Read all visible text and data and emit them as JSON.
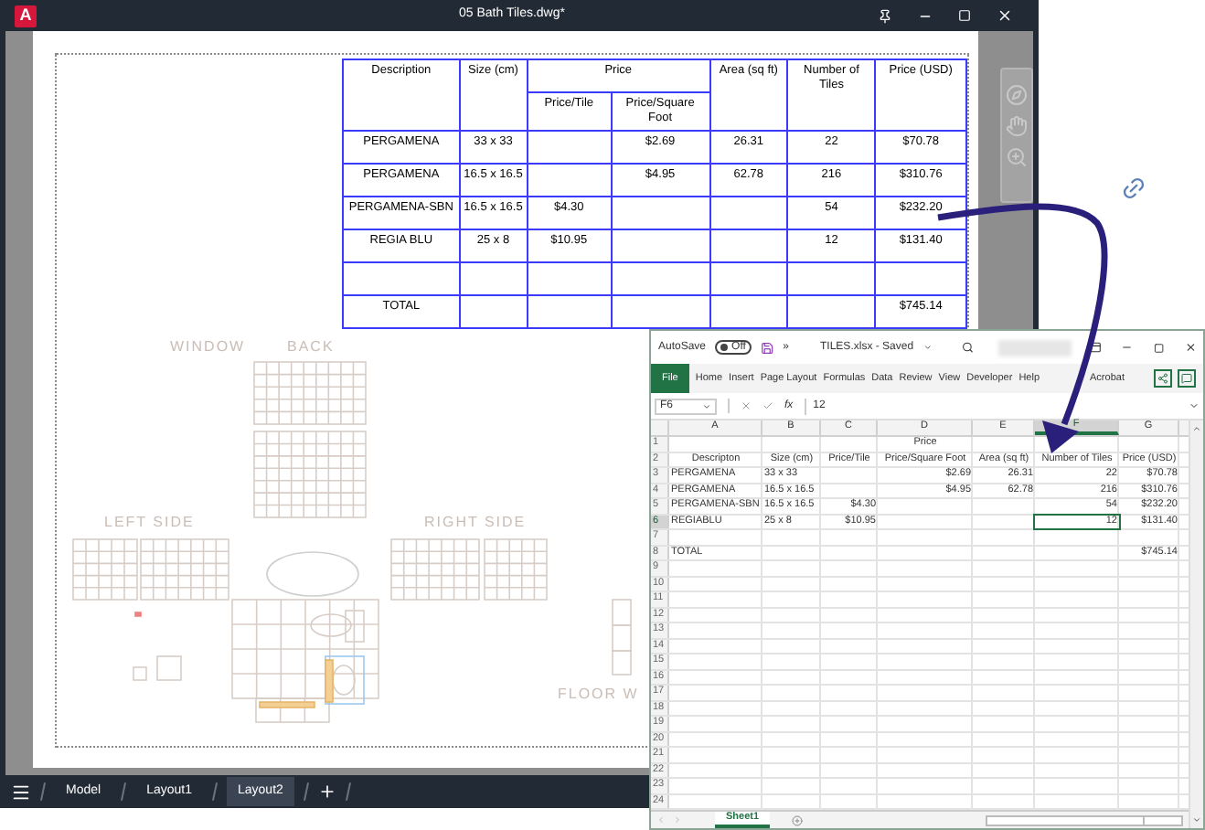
{
  "cad": {
    "logo": "A",
    "title": "05 Bath Tiles.dwg*",
    "table": {
      "headers": [
        {
          "label": "Description"
        },
        {
          "label": "Size (cm)"
        },
        {
          "label": "Price",
          "sub": [
            "Price/Tile",
            "Price/Square Foot"
          ]
        },
        {
          "label": "Area (sq ft)"
        },
        {
          "label": "Number of Tiles"
        },
        {
          "label": "Price (USD)"
        }
      ],
      "rows": [
        [
          "PERGAMENA",
          "33 x 33",
          null,
          "$2.69",
          "26.31",
          "22",
          "$70.78"
        ],
        [
          "PERGAMENA",
          "16.5 x 16.5",
          null,
          "$4.95",
          "62.78",
          "216",
          "$310.76"
        ],
        [
          "PERGAMENA-SBN",
          "16.5 x 16.5",
          "$4.30",
          null,
          null,
          "54",
          "$232.20"
        ],
        [
          "REGIA BLU",
          "25 x 8",
          "$10.95",
          null,
          null,
          "12",
          "$131.40"
        ],
        [],
        [
          "TOTAL",
          null,
          null,
          null,
          null,
          null,
          "$745.14"
        ]
      ]
    },
    "labels": [
      "WINDOW",
      "BACK",
      "LEFT SIDE",
      "RIGHT SIDE",
      "FLOOR W"
    ],
    "layout_tabs": [
      {
        "label": "Model",
        "selected": false
      },
      {
        "label": "Layout1",
        "selected": false
      },
      {
        "label": "Layout2",
        "selected": true
      }
    ]
  },
  "excel": {
    "autosave": {
      "label": "AutoSave",
      "on": false,
      "state_label": "Off"
    },
    "more": "»",
    "title": "TILES.xlsx - Saved",
    "ribbon_tabs": [
      {
        "label": "File",
        "kind": "file"
      },
      {
        "label": "Home",
        "kind": "tab"
      },
      {
        "label": "Insert",
        "kind": "tab"
      },
      {
        "label": "Page Layout",
        "kind": "tab"
      },
      {
        "label": "Formulas",
        "kind": "tab"
      },
      {
        "label": "Data",
        "kind": "tab"
      },
      {
        "label": "Review",
        "kind": "tab"
      },
      {
        "label": "View",
        "kind": "tab"
      },
      {
        "label": "Developer",
        "kind": "tab"
      },
      {
        "label": "Help",
        "kind": "tab"
      },
      {
        "label": "Acrobat",
        "kind": "tab"
      }
    ],
    "name_box": "F6",
    "function_label": "fx",
    "formula": "12",
    "columns": [
      {
        "label": "A",
        "selected": false
      },
      {
        "label": "B",
        "selected": false
      },
      {
        "label": "C",
        "selected": false
      },
      {
        "label": "D",
        "selected": false
      },
      {
        "label": "E",
        "selected": false
      },
      {
        "label": "F",
        "selected": true
      },
      {
        "label": "G",
        "selected": false
      }
    ],
    "rows": [
      {
        "number": "1",
        "kind": "header",
        "selected": false,
        "cells": [
          null,
          null,
          null,
          "Price",
          null,
          null,
          null
        ]
      },
      {
        "number": "2",
        "kind": "header",
        "selected": false,
        "cells": [
          "Descripton",
          "Size (cm)",
          "Price/Tile",
          "Price/Square Foot",
          "Area (sq ft)",
          "Number of Tiles",
          "Price (USD)"
        ]
      },
      {
        "number": "3",
        "kind": "data",
        "selected": false,
        "cells": [
          "PERGAMENA",
          "33 x 33",
          null,
          "$2.69",
          "26.31",
          "22",
          "$70.78"
        ]
      },
      {
        "number": "4",
        "kind": "data",
        "selected": false,
        "cells": [
          "PERGAMENA",
          "16.5 x 16.5",
          null,
          "$4.95",
          "62.78",
          "216",
          "$310.76"
        ]
      },
      {
        "number": "5",
        "kind": "data",
        "selected": false,
        "cells": [
          "PERGAMENA-SBN",
          "16.5 x 16.5",
          "$4.30",
          null,
          null,
          "54",
          "$232.20"
        ]
      },
      {
        "number": "6",
        "kind": "data",
        "selected": true,
        "cells": [
          "REGIABLU",
          "25 x 8",
          "$10.95",
          null,
          null,
          "12",
          "$131.40"
        ]
      },
      {
        "number": "7",
        "kind": "data",
        "selected": false
      },
      {
        "number": "8",
        "kind": "data",
        "selected": false,
        "cells": [
          "TOTAL",
          null,
          null,
          null,
          null,
          null,
          "$745.14"
        ]
      },
      {
        "number": "9",
        "kind": "data",
        "selected": false
      },
      {
        "number": "10",
        "kind": "data",
        "selected": false
      },
      {
        "number": "11",
        "kind": "data",
        "selected": false
      },
      {
        "number": "12",
        "kind": "data",
        "selected": false
      },
      {
        "number": "13",
        "kind": "data",
        "selected": false
      },
      {
        "number": "14",
        "kind": "data",
        "selected": false
      },
      {
        "number": "15",
        "kind": "data",
        "selected": false
      },
      {
        "number": "16",
        "kind": "data",
        "selected": false
      },
      {
        "number": "17",
        "kind": "data",
        "selected": false
      },
      {
        "number": "18",
        "kind": "data",
        "selected": false
      },
      {
        "number": "19",
        "kind": "data",
        "selected": false
      },
      {
        "number": "20",
        "kind": "data",
        "selected": false
      },
      {
        "number": "21",
        "kind": "data",
        "selected": false
      },
      {
        "number": "22",
        "kind": "data",
        "selected": false
      },
      {
        "number": "23",
        "kind": "data",
        "selected": false
      },
      {
        "number": "24",
        "kind": "data",
        "selected": false
      }
    ],
    "sheet_tabs": [
      {
        "label": "Sheet1",
        "selected": true
      }
    ]
  }
}
